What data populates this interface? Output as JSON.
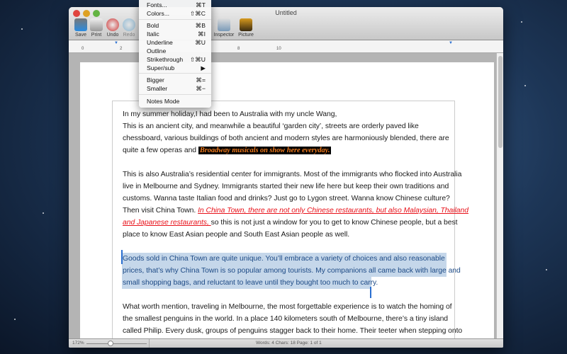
{
  "window": {
    "title": "Untitled"
  },
  "toolbar": [
    {
      "label": "Save",
      "icon": "save-icon"
    },
    {
      "label": "Print",
      "icon": "print-icon"
    },
    {
      "label": "Undo",
      "icon": "undo-icon"
    },
    {
      "label": "Redo",
      "icon": "redo-icon"
    },
    {
      "label": "Inspector",
      "icon": "inspector-icon"
    },
    {
      "label": "Picture",
      "icon": "picture-icon"
    }
  ],
  "ruler": {
    "ticks": [
      "0",
      "2",
      "8",
      "10"
    ]
  },
  "menu": {
    "items": [
      {
        "label": "Fonts...",
        "shortcut": "⌘T"
      },
      {
        "label": "Colors...",
        "shortcut": "⇧⌘C"
      },
      {
        "label": "Bold",
        "shortcut": "⌘B"
      },
      {
        "label": "Italic",
        "shortcut": "⌘I"
      },
      {
        "label": "Underline",
        "shortcut": "⌘U"
      },
      {
        "label": "Outline",
        "shortcut": ""
      },
      {
        "label": "Strikethrough",
        "shortcut": "⇧⌘U"
      },
      {
        "label": "Super/sub",
        "shortcut": "▶"
      },
      {
        "label": "Bigger",
        "shortcut": "⌘="
      },
      {
        "label": "Smaller",
        "shortcut": "⌘−"
      },
      {
        "label": "Notes Mode",
        "shortcut": ""
      }
    ]
  },
  "doc": {
    "l1": "In my summer holiday,I had been to Australia with my uncle Wang,",
    "l2": "This is an ancient city, and meanwhile a beautiful ‘garden city’, streets are orderly paved like",
    "l3": "chessboard, various buildings of both ancient and modern styles are harmoniously blended, there are",
    "l4a": "quite a few operas and ",
    "l4b": "Broadway musicals on show here everyday.",
    "l5": "This is also Australia’s residential center for immigrants. Most of the immigrants who flocked into Australia",
    "l6": "live in Melbourne and Sydney. Immigrants started their new life here but keep their own traditions and",
    "l7": "customs. Wanna taste Italian food and drinks? Just go to Lygon street. Wanna know Chinese culture?",
    "l8a": "Then visit China Town. ",
    "l8b": "In China Town, there are not only Chinese restaurants, but also Malaysian, Thailand",
    "l9a": "and Japanese restaurants, ",
    "l9b": "so this is not just a window for you to get to know Chinese people, but a best",
    "l10": "place to know East Asian people and South East Asian people as well.",
    "l11": "Goods sold in China Town are quite unique. You’ll embrace a variety of choices and also reasonable",
    "l12": "prices, that’s why China Town is so popular among tourists. My companions all came back with large and",
    "l13": "small shopping bags, and reluctant to leave until they bought too much to carry.",
    "l14": "What worth mention, traveling in Melbourne, the most forgettable experience is to watch the homing of",
    "l15": "the smallest penguins in the world. In a place 140 kilometers south of Melbourne, there’s a tiny island",
    "l16": "called Philip. Every dusk, groups of penguins stagger back to their home. Their teeter when stepping onto"
  },
  "status": {
    "zoom": "172%",
    "zoom_fraction": 0.4,
    "info": "Words: 4  Chars: 18  Page: 1 of 1"
  }
}
